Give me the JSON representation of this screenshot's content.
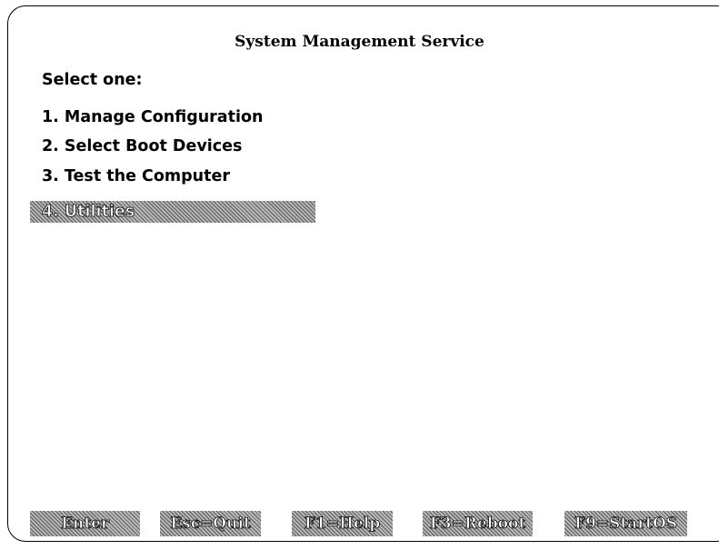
{
  "header": {
    "title": "System Management Service"
  },
  "menu": {
    "prompt": "Select one:",
    "items": [
      {
        "label": "1. Manage Configuration",
        "selected": false
      },
      {
        "label": "2. Select Boot Devices",
        "selected": false
      },
      {
        "label": "3. Test the Computer",
        "selected": false
      },
      {
        "label": "4. Utilities",
        "selected": true
      }
    ]
  },
  "function_keys": [
    {
      "label": "Enter"
    },
    {
      "label": "Esc=Quit"
    },
    {
      "label": "F1=Help"
    },
    {
      "label": "F3=Reboot"
    },
    {
      "label": "F9=StartOS"
    }
  ],
  "colors": {
    "background": "#ffffff",
    "text": "#000000",
    "highlight_pattern": "#5a5a5a"
  }
}
